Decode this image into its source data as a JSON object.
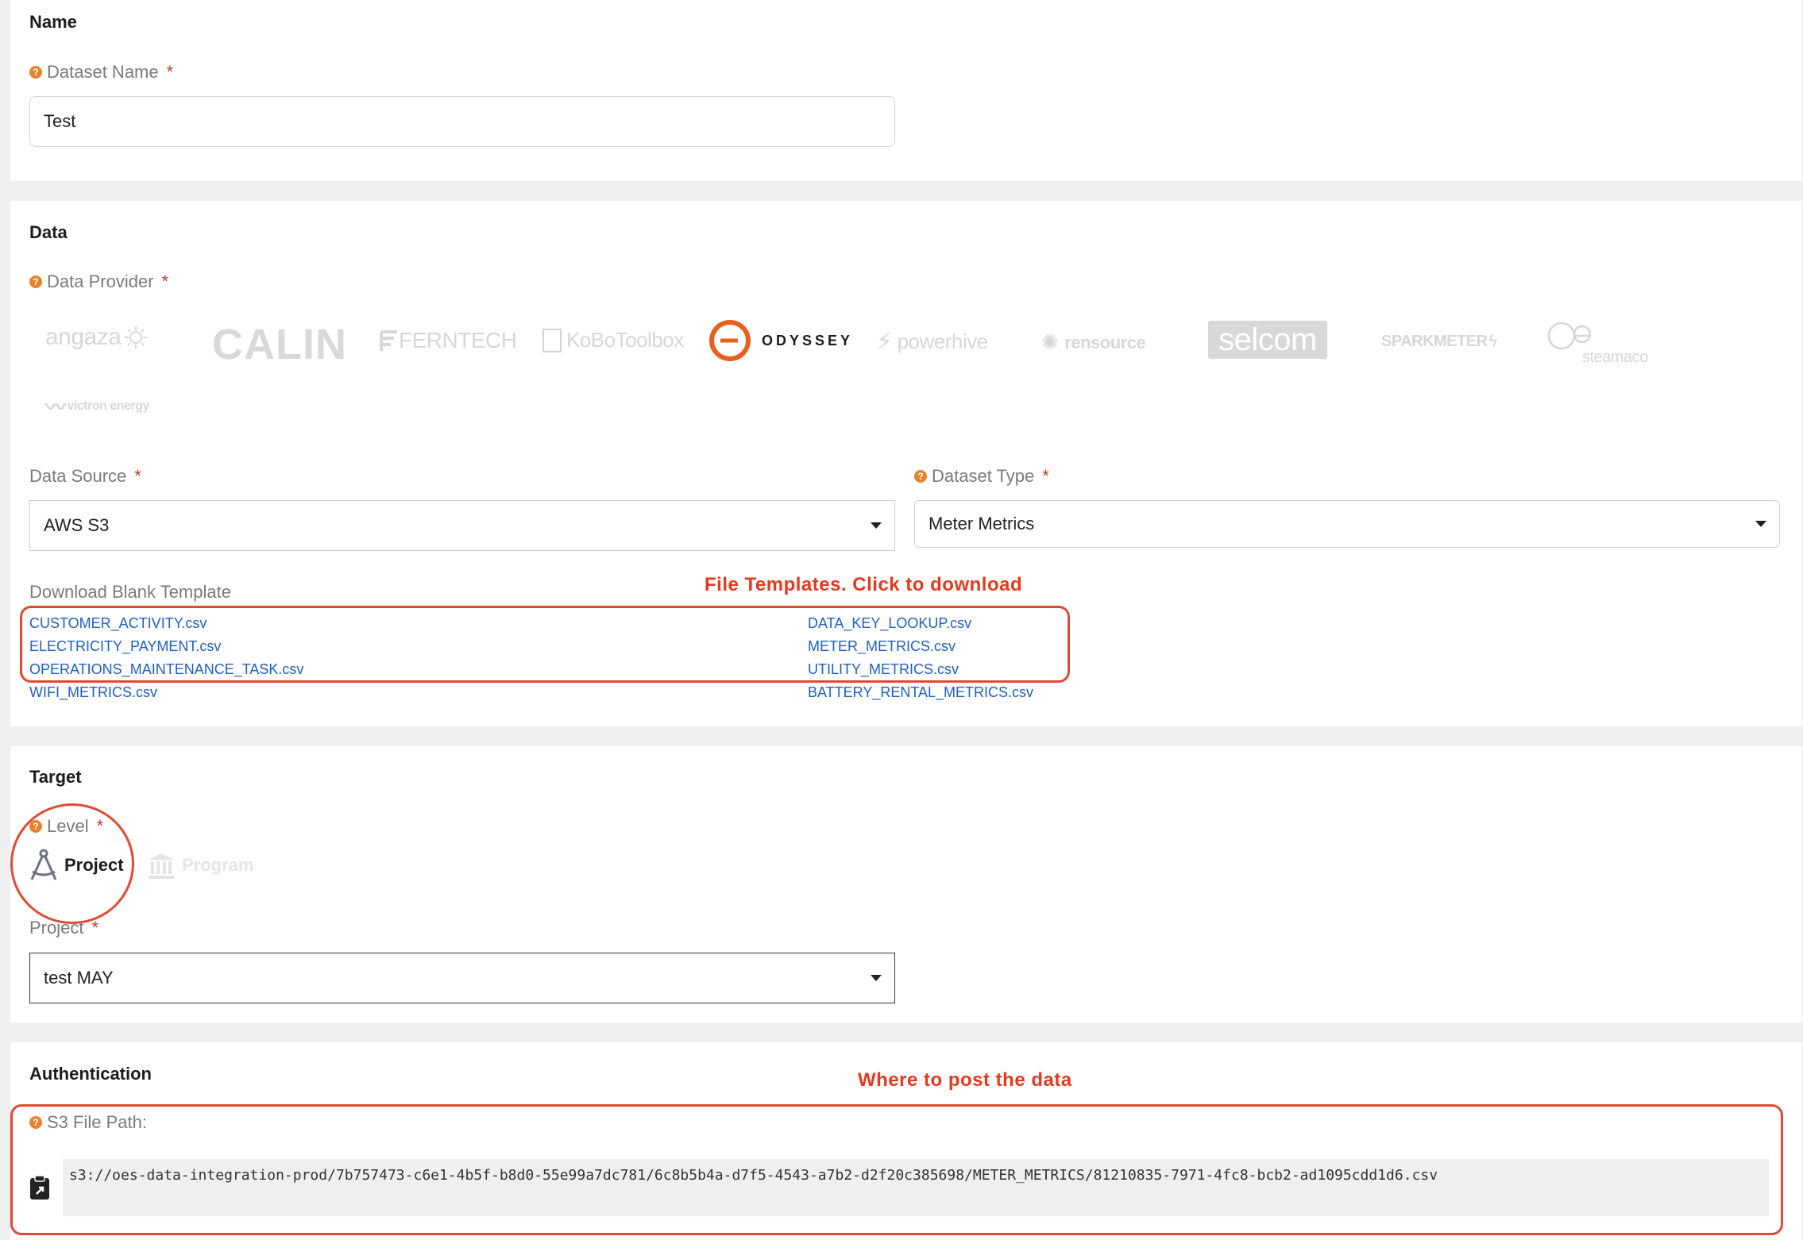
{
  "name_section": {
    "title": "Name",
    "dataset_name_label": "Dataset Name",
    "dataset_name_value": "Test"
  },
  "data_section": {
    "title": "Data",
    "provider_label": "Data Provider",
    "providers": [
      "angaza",
      "CALIN",
      "FERNTECH",
      "KoBoToolbox",
      "ODYSSEY",
      "powerhive",
      "rensource",
      "selcom",
      "SPARKMETER",
      "steamaco",
      "victron energy"
    ],
    "selected_provider": "ODYSSEY",
    "source_label": "Data Source",
    "source_value": "AWS S3",
    "type_label": "Dataset Type",
    "type_value": "Meter Metrics",
    "template_label": "Download Blank Template",
    "templates_left": [
      "CUSTOMER_ACTIVITY.csv",
      "ELECTRICITY_PAYMENT.csv",
      "OPERATIONS_MAINTENANCE_TASK.csv",
      "WIFI_METRICS.csv"
    ],
    "templates_right": [
      "DATA_KEY_LOOKUP.csv",
      "METER_METRICS.csv",
      "UTILITY_METRICS.csv",
      "BATTERY_RENTAL_METRICS.csv"
    ],
    "annotation": "File Templates. Click to download"
  },
  "target_section": {
    "title": "Target",
    "level_label": "Level",
    "level_project": "Project",
    "level_program": "Program",
    "project_label": "Project",
    "project_value": "test MAY"
  },
  "auth_section": {
    "title": "Authentication",
    "s3_label": "S3 File Path:",
    "s3_path": "s3://oes-data-integration-prod/7b757473-c6e1-4b5f-b8d0-55e99a7dc781/6c8b5b4a-d7f5-4543-a7b2-d2f20c385698/METER_METRICS/81210835-7971-4fc8-bcb2-ad1095cdd1d6.csv",
    "annotation": "Where to post the data"
  },
  "colors": {
    "accent": "#e8832d",
    "required": "#c0392b",
    "annotation": "#e23a1e",
    "link": "#1f5fbf"
  }
}
